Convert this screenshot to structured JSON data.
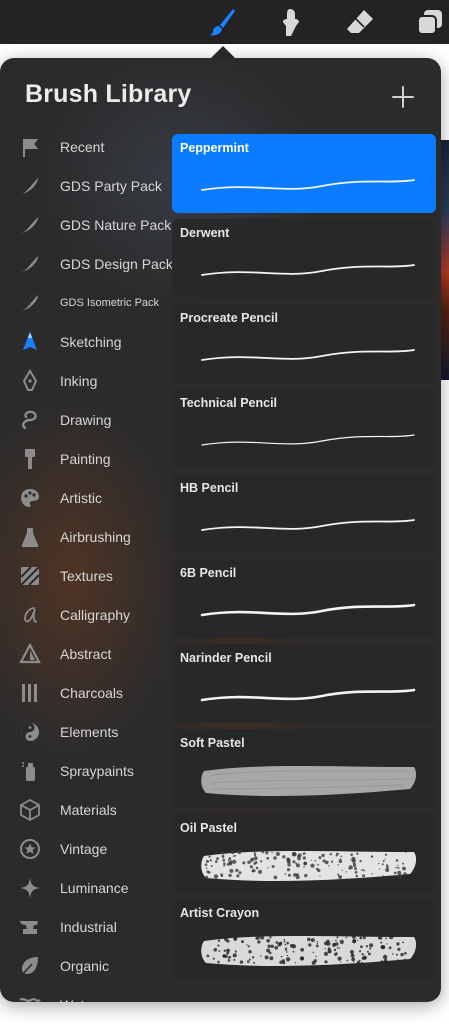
{
  "toolbar": {
    "tools": [
      {
        "name": "brush-tool",
        "icon": "brush-icon",
        "active": true,
        "color": "#1a82ff"
      },
      {
        "name": "smudge-tool",
        "icon": "smudge-icon",
        "active": false
      },
      {
        "name": "eraser-tool",
        "icon": "eraser-icon",
        "active": false
      },
      {
        "name": "layers-tool",
        "icon": "layers-icon",
        "active": false
      }
    ]
  },
  "panel": {
    "title": "Brush Library",
    "add_icon": "plus-icon"
  },
  "categories": [
    {
      "label": "Recent",
      "icon": "flag-icon"
    },
    {
      "label": "GDS Party Pack",
      "icon": "stroke-icon"
    },
    {
      "label": "GDS Nature Pack",
      "icon": "stroke-icon"
    },
    {
      "label": "GDS Design Pack",
      "icon": "stroke-icon"
    },
    {
      "label": "GDS Isometric Pack",
      "icon": "stroke-icon"
    },
    {
      "label": "Sketching",
      "icon": "pencil-tip-icon",
      "active": true
    },
    {
      "label": "Inking",
      "icon": "pen-nib-icon"
    },
    {
      "label": "Drawing",
      "icon": "squiggle-icon"
    },
    {
      "label": "Painting",
      "icon": "paint-brush-icon"
    },
    {
      "label": "Artistic",
      "icon": "palette-icon"
    },
    {
      "label": "Airbrushing",
      "icon": "airbrush-icon"
    },
    {
      "label": "Textures",
      "icon": "texture-icon"
    },
    {
      "label": "Calligraphy",
      "icon": "calligraphy-icon"
    },
    {
      "label": "Abstract",
      "icon": "triangle-icon"
    },
    {
      "label": "Charcoals",
      "icon": "charcoal-icon"
    },
    {
      "label": "Elements",
      "icon": "yin-yang-icon"
    },
    {
      "label": "Spraypaints",
      "icon": "spray-can-icon"
    },
    {
      "label": "Materials",
      "icon": "cube-icon"
    },
    {
      "label": "Vintage",
      "icon": "star-badge-icon"
    },
    {
      "label": "Luminance",
      "icon": "sparkle-icon"
    },
    {
      "label": "Industrial",
      "icon": "anvil-icon"
    },
    {
      "label": "Organic",
      "icon": "leaf-icon"
    },
    {
      "label": "Water",
      "icon": "waves-icon"
    }
  ],
  "brushes": [
    {
      "name": "Peppermint",
      "selected": true,
      "stroke": "fine"
    },
    {
      "name": "Derwent",
      "selected": false,
      "stroke": "fine"
    },
    {
      "name": "Procreate Pencil",
      "selected": false,
      "stroke": "fine"
    },
    {
      "name": "Technical Pencil",
      "selected": false,
      "stroke": "thin"
    },
    {
      "name": "HB Pencil",
      "selected": false,
      "stroke": "fine"
    },
    {
      "name": "6B Pencil",
      "selected": false,
      "stroke": "medium"
    },
    {
      "name": "Narinder Pencil",
      "selected": false,
      "stroke": "medium"
    },
    {
      "name": "Soft Pastel",
      "selected": false,
      "stroke": "wide-soft"
    },
    {
      "name": "Oil Pastel",
      "selected": false,
      "stroke": "wide-grainy"
    },
    {
      "name": "Artist Crayon",
      "selected": false,
      "stroke": "wide-crayon"
    }
  ],
  "colors": {
    "accent": "#0b7cff",
    "panel_bg": "#2b2b2c",
    "toolbar_bg": "#232323"
  }
}
